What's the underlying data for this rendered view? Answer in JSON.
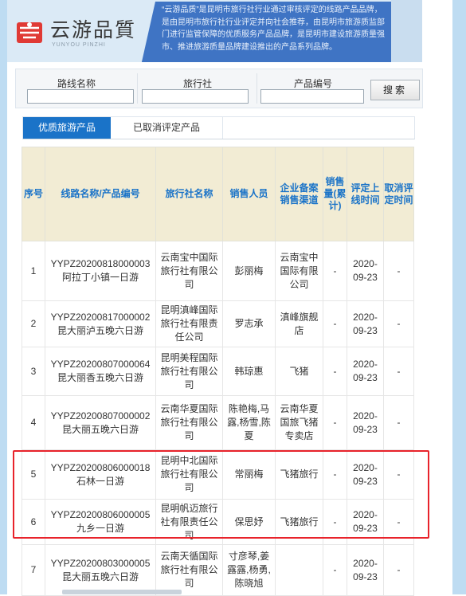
{
  "banner": {
    "logo_text": "云游品質",
    "logo_sub": "YUNYOU PINZHI",
    "intro": "“云游品质”是昆明市旅行社行业通过审核评定的线路产品品牌，是由昆明市旅行社行业评定并向社会推荐，由昆明市旅游质监部门进行监管保障的优质服务产品品牌，是昆明市建设旅游质量强市、推进旅游质量品牌建设推出的产品系列品牌。"
  },
  "search": {
    "route_label": "路线名称",
    "agency_label": "旅行社",
    "code_label": "产品编号",
    "button": "搜索"
  },
  "tabs": [
    {
      "label": "优质旅游产品"
    },
    {
      "label": "已取消评定产品"
    }
  ],
  "table": {
    "headers": {
      "no": "序号",
      "route": "线路名称/产品编号",
      "agency": "旅行社名称",
      "seller": "销售人员",
      "channel": "企业备案销售渠道",
      "sales": "销售量(累计)",
      "online": "评定上线时间",
      "cancel": "取消评定时间"
    },
    "rows": [
      {
        "no": "1",
        "code": "YYPZ20200818000003",
        "name": "阿拉丁小镇一日游",
        "agency": "云南宝中国际旅行社有限公司",
        "seller": "彭丽梅",
        "channel": "云南宝中国际有限公司",
        "sales": "-",
        "online": "2020-09-23",
        "cancel": "-"
      },
      {
        "no": "2",
        "code": "YYPZ20200817000002",
        "name": "昆大丽泸五晚六日游",
        "agency": "昆明滇峰国际旅行社有限责任公司",
        "seller": "罗志承",
        "channel": "滇峰旗舰店",
        "sales": "-",
        "online": "2020-09-23",
        "cancel": "-"
      },
      {
        "no": "3",
        "code": "YYPZ20200807000064",
        "name": "昆大丽香五晚六日游",
        "agency": "昆明美程国际旅行社有限公司",
        "seller": "韩琼惠",
        "channel": "飞猪",
        "sales": "-",
        "online": "2020-09-23",
        "cancel": "-"
      },
      {
        "no": "4",
        "code": "YYPZ20200807000002",
        "name": "昆大丽五晚六日游",
        "agency": "云南华夏国际旅行社有限公司",
        "seller": "陈艳梅,马露,杨雪,陈夏",
        "channel": "云南华夏国旅飞猪专卖店",
        "sales": "-",
        "online": "2020-09-23",
        "cancel": "-"
      },
      {
        "no": "5",
        "code": "YYPZ20200806000018",
        "name": "石林一日游",
        "agency": "昆明中北国际旅行社有限公司",
        "seller": "常丽梅",
        "channel": "飞猪旅行",
        "sales": "-",
        "online": "2020-09-23",
        "cancel": "-"
      },
      {
        "no": "6",
        "code": "YYPZ20200806000005",
        "name": "九乡一日游",
        "agency": "昆明帆迈旅行社有限责任公司",
        "seller": "保思妤",
        "channel": "飞猪旅行",
        "sales": "-",
        "online": "2020-09-23",
        "cancel": "-"
      },
      {
        "no": "7",
        "code": "YYPZ20200803000005",
        "name": "昆大丽五晚六日游",
        "agency": "云南天循国际旅行社有限公司",
        "seller": "寸彦琴,姜露露,杨勇,陈晓旭",
        "channel": "",
        "sales": "-",
        "online": "2020-09-23",
        "cancel": "-"
      }
    ]
  },
  "colors": {
    "accent": "#1a73c8",
    "header_bg": "#f2ecd4",
    "highlight": "#e8232b",
    "side": "#bedcf2"
  }
}
